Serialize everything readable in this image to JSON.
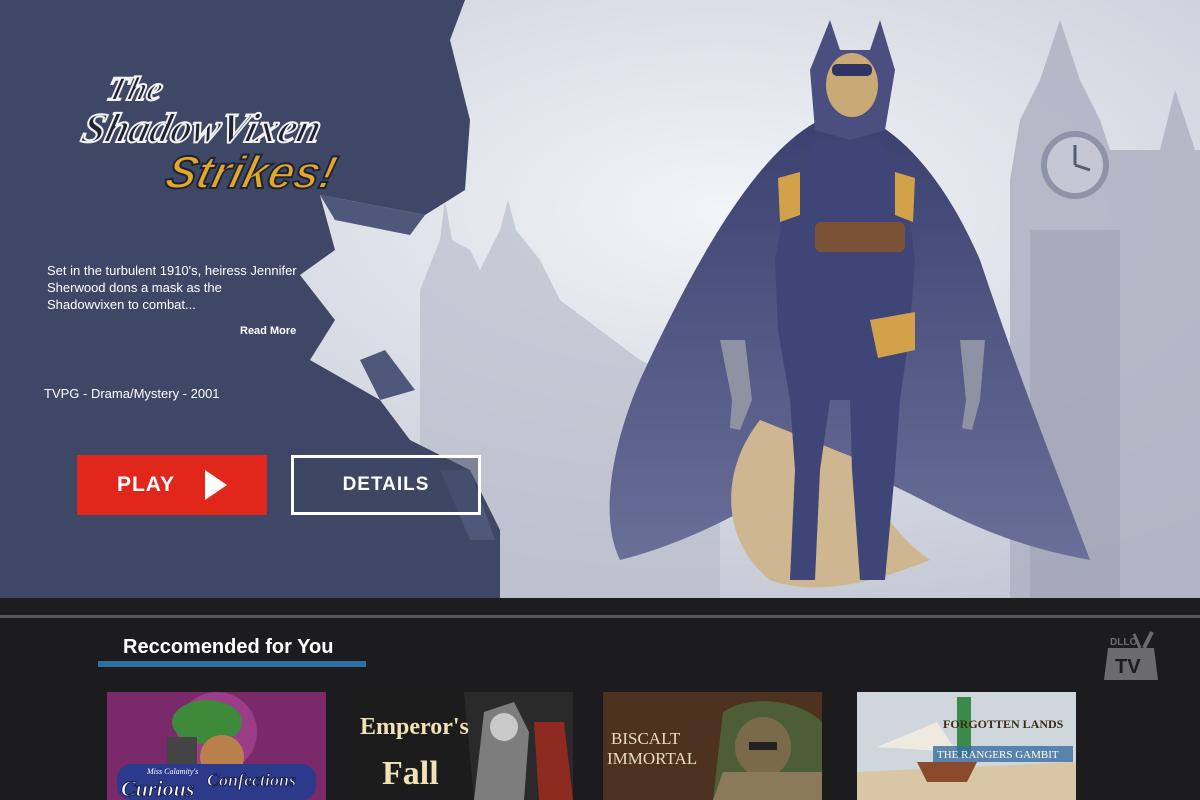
{
  "hero": {
    "logo_line1": "The",
    "logo_line2": "ShadowVixen",
    "logo_line3": "Strikes!",
    "synopsis": "Set in the turbulent 1910's, heiress Jennifer Sherwood dons a mask as the Shadowvixen to combat...",
    "read_more": "Read More",
    "meta": "TVPG  -  Drama/Mystery  -  2001",
    "play_label": "PLAY",
    "details_label": "DETAILS"
  },
  "recommended": {
    "title": "Reccomended for You",
    "items": [
      {
        "title_small": "Miss Calamity's",
        "title_1": "Curious",
        "title_2": "Confections"
      },
      {
        "title_1": "Emperor's",
        "title_2": "Fall"
      },
      {
        "title_1": "BISCALT",
        "title_2": "IMMORTAL"
      },
      {
        "title_1": "FORGOTTEN LANDS",
        "title_2": "THE RANGERS GAMBIT"
      }
    ]
  },
  "brand": {
    "line1": "DLLO",
    "line2": "TV"
  },
  "colors": {
    "accent_red": "#e1261c",
    "accent_blue": "#2c6fa0",
    "panel": "#3e4866"
  }
}
